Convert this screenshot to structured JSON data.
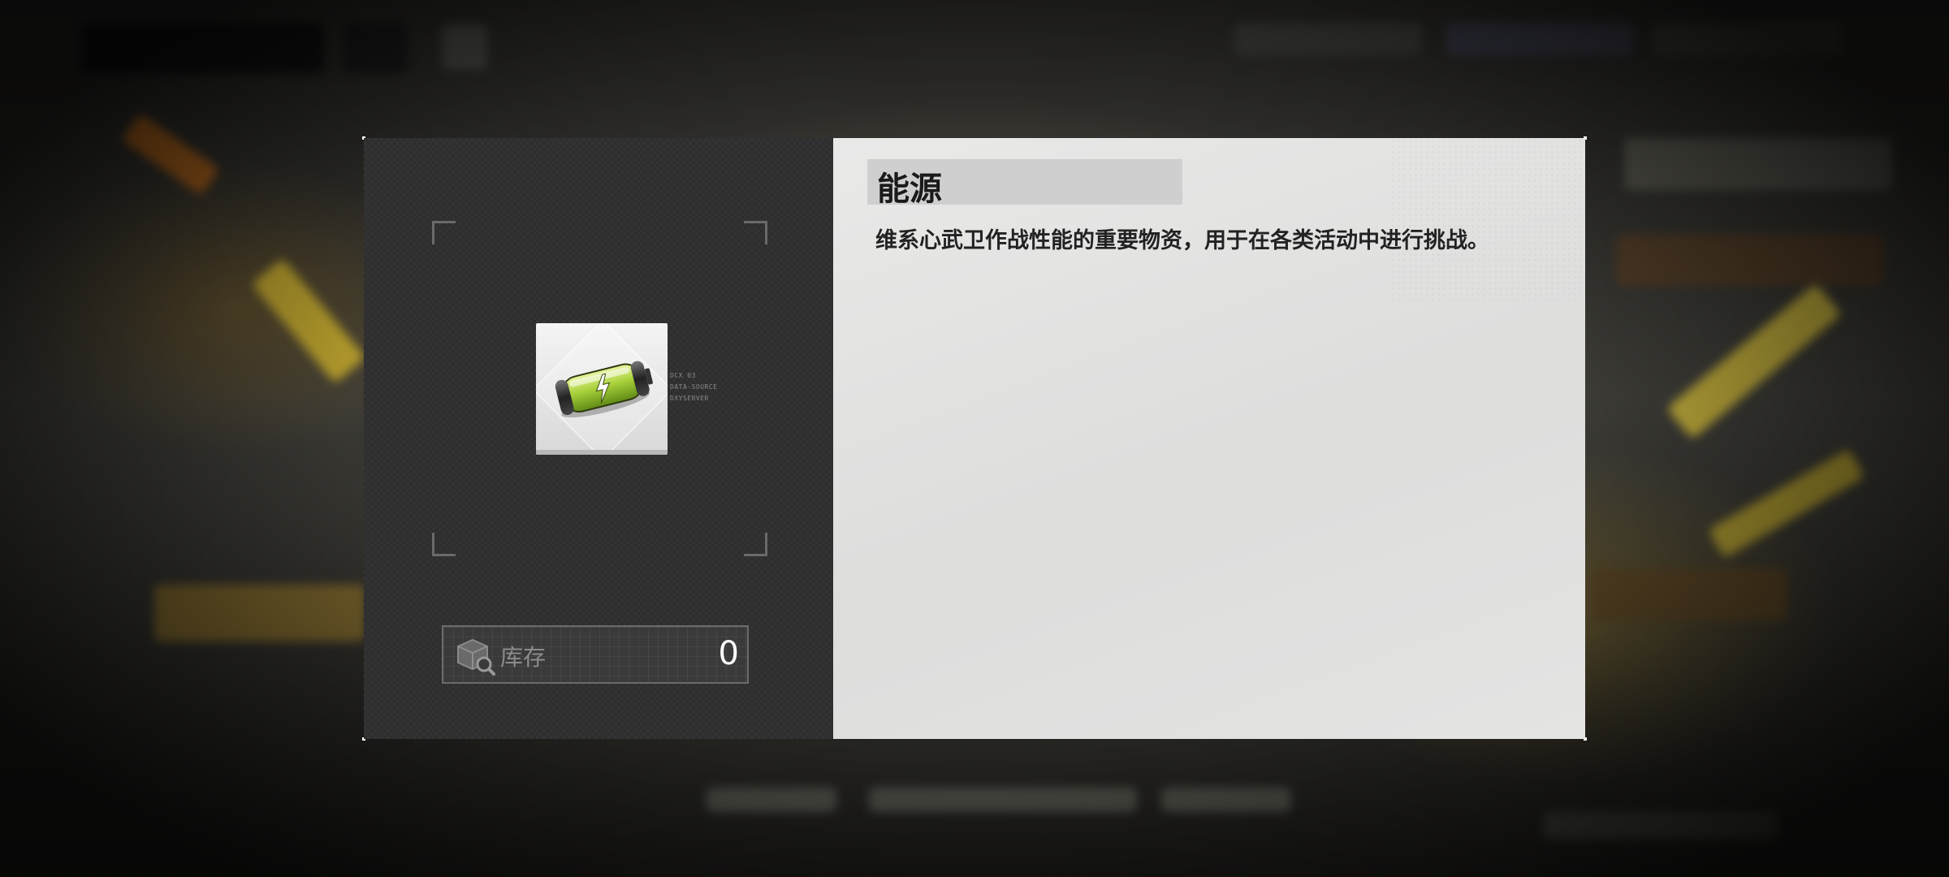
{
  "item": {
    "name": "能源",
    "description": "维系心武卫作战性能的重要物资，用于在各类活动中进行挑战。",
    "icon": "battery-energy-icon",
    "tiny_labels": [
      "DCX 03",
      "DATA-SOURCE",
      "DXYSERVER"
    ]
  },
  "inventory": {
    "label": "库存",
    "count": "0",
    "icon": "box-search-icon"
  },
  "colors": {
    "left_panel": "#2e2e2e",
    "right_panel": "#e2e2e1",
    "title_bar": "#cfcfcf",
    "battery_green": "#b6d84a"
  }
}
